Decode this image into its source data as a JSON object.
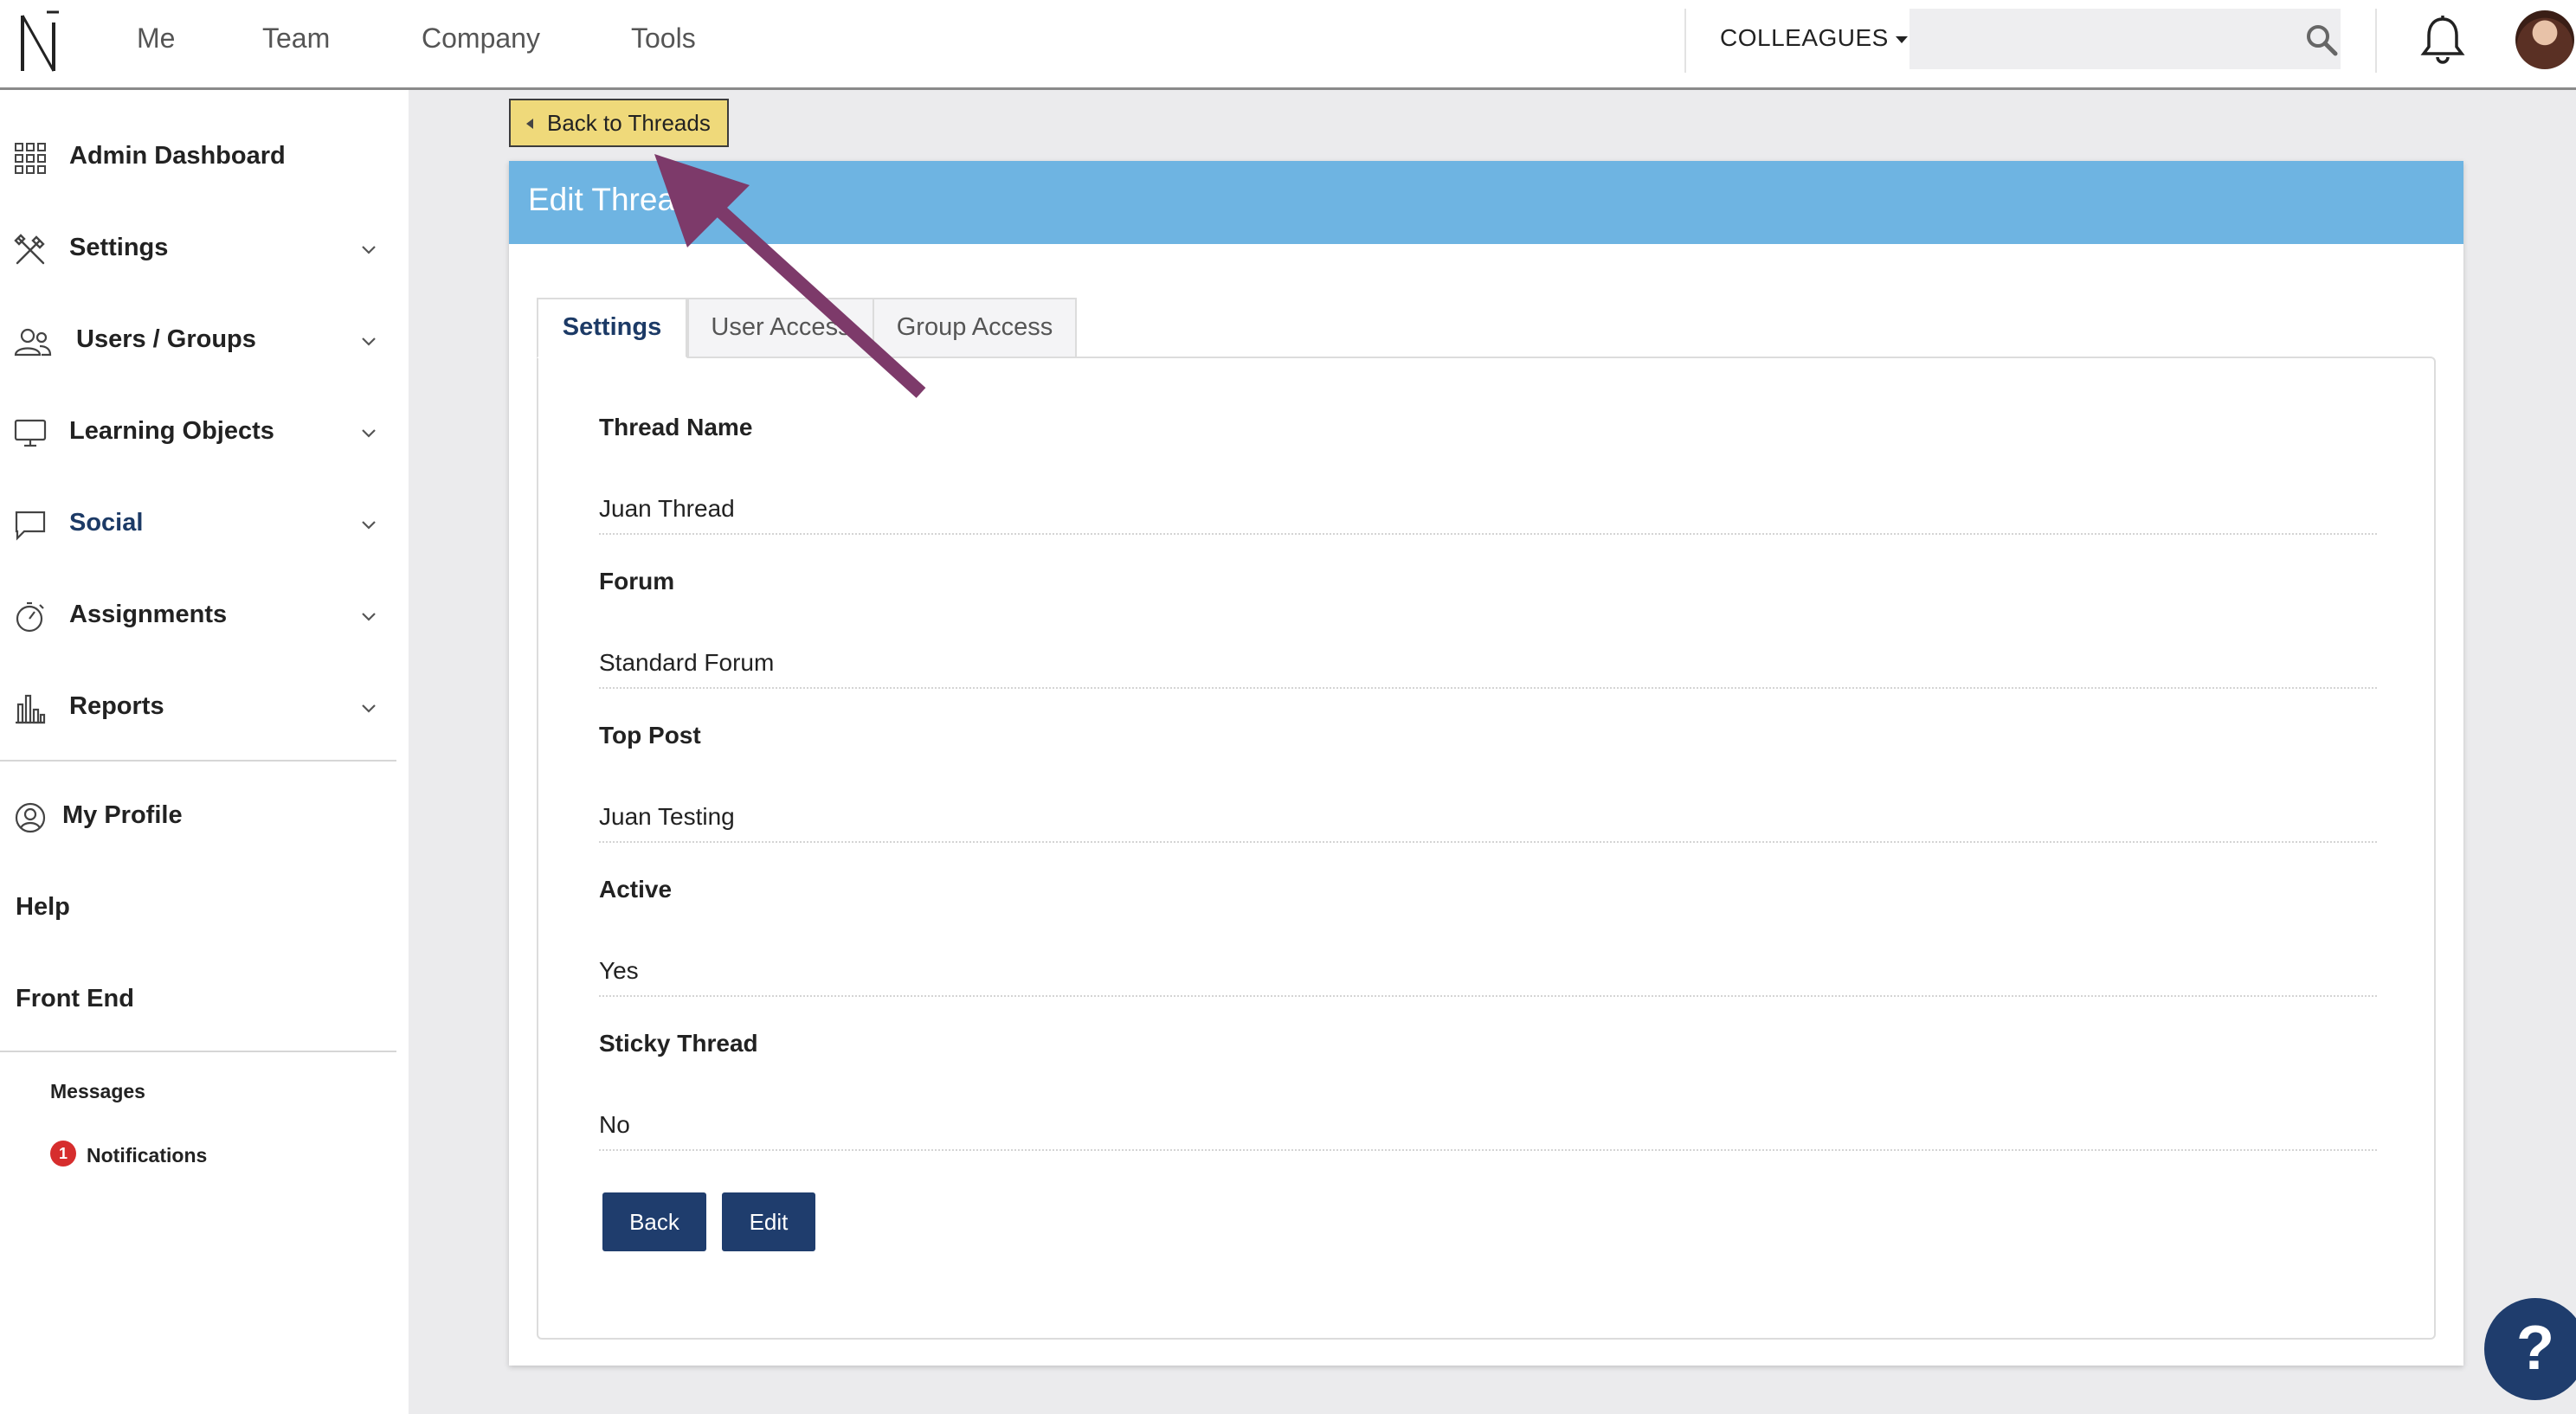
{
  "topnav": {
    "items": [
      "Me",
      "Team",
      "Company",
      "Tools"
    ],
    "colleagues_label": "COLLEAGUES",
    "search_value": "",
    "search_placeholder": ""
  },
  "sidebar": {
    "items": [
      {
        "label": "Admin Dashboard",
        "icon": "grid-icon"
      },
      {
        "label": "Settings",
        "icon": "tools-icon"
      },
      {
        "label": "Users / Groups",
        "icon": "users-icon"
      },
      {
        "label": "Learning Objects",
        "icon": "monitor-icon"
      },
      {
        "label": "Social",
        "icon": "chat-icon"
      },
      {
        "label": "Assignments",
        "icon": "stopwatch-icon"
      },
      {
        "label": "Reports",
        "icon": "bar-chart-icon"
      }
    ],
    "profile": "My Profile",
    "help": "Help",
    "front_end": "Front End",
    "messages": "Messages",
    "notifications": "Notifications",
    "notifications_count": "1"
  },
  "main": {
    "back_to_threads": "Back to Threads",
    "title": "Edit Thread",
    "tabs": [
      "Settings",
      "User Access",
      "Group Access"
    ],
    "fields": [
      {
        "label": "Thread Name",
        "value": "Juan Thread"
      },
      {
        "label": "Forum",
        "value": "Standard Forum"
      },
      {
        "label": "Top Post",
        "value": "Juan Testing"
      },
      {
        "label": "Active",
        "value": "Yes"
      },
      {
        "label": "Sticky Thread",
        "value": "No"
      }
    ],
    "back_button": "Back",
    "edit_button": "Edit"
  },
  "help_button": "?",
  "colors": {
    "header_blue": "#6eb4e2",
    "button_navy": "#1f3d6d",
    "back_threads_yellow": "#efd97a",
    "arrow_purple": "#7d3a6a",
    "badge_red": "#d62d2d"
  }
}
